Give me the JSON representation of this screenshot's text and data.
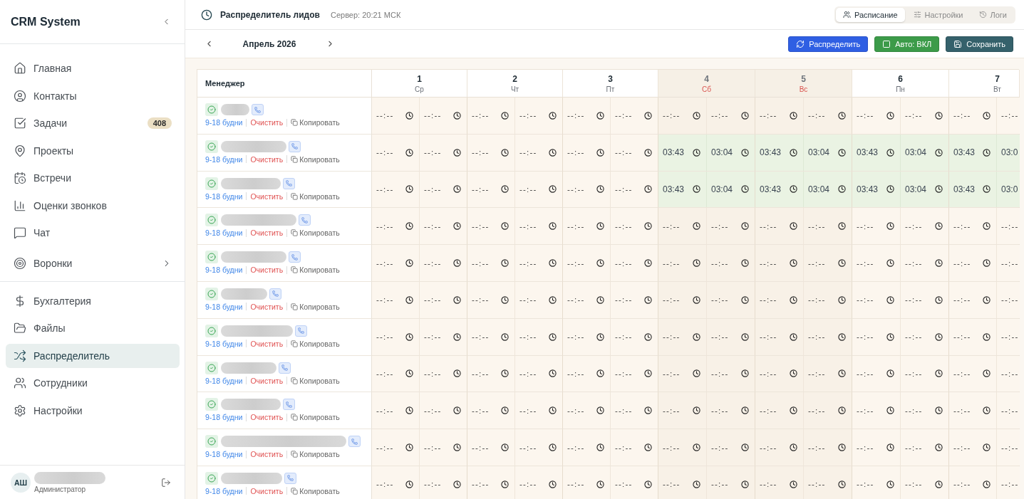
{
  "sidebar": {
    "brand": "CRM System",
    "sections": [
      {
        "items": [
          {
            "kind": "link",
            "label": "Главная",
            "selected": false
          },
          {
            "kind": "link",
            "label": "Контакты",
            "selected": false
          },
          {
            "kind": "link",
            "label": "Задачи",
            "selected": false,
            "badge": "408"
          },
          {
            "kind": "link",
            "label": "Проекты",
            "selected": false
          },
          {
            "kind": "link",
            "label": "Встречи",
            "selected": false
          },
          {
            "kind": "link",
            "label": "Оценки звонков",
            "selected": false
          },
          {
            "kind": "link",
            "label": "Чат",
            "selected": false
          },
          {
            "kind": "group",
            "label": "Воронки",
            "selected": false,
            "expanded": false
          }
        ]
      },
      {
        "items": [
          {
            "kind": "link",
            "label": "Бухгалтерия",
            "selected": false
          },
          {
            "kind": "link",
            "label": "Файлы",
            "selected": false
          },
          {
            "kind": "link",
            "label": "Распределитель",
            "selected": true
          },
          {
            "kind": "link",
            "label": "Сотрудники",
            "selected": false
          },
          {
            "kind": "link",
            "label": "Настройки",
            "selected": false
          }
        ]
      }
    ],
    "user": {
      "initials": "АШ",
      "role": "Администратор"
    }
  },
  "header": {
    "title": "Распределитель лидов",
    "server_time": "Сервер: 20:21 МСК",
    "tabs": [
      {
        "label": "Расписание",
        "selected": true
      },
      {
        "label": "Настройки",
        "selected": false
      },
      {
        "label": "Логи",
        "selected": false
      }
    ]
  },
  "toolbar": {
    "month": "Апрель 2026",
    "buttons": [
      {
        "kind": "distribute",
        "label": "Распределить"
      },
      {
        "kind": "auto",
        "label": "Авто: ВКЛ",
        "on": true
      },
      {
        "kind": "save",
        "label": "Сохранить"
      }
    ]
  },
  "table": {
    "manager_header": "Менеджер",
    "days": [
      {
        "date": "1",
        "weekday": "Ср",
        "weekend": false
      },
      {
        "date": "2",
        "weekday": "Чт",
        "weekend": false
      },
      {
        "date": "3",
        "weekday": "Пт",
        "weekend": false
      },
      {
        "date": "4",
        "weekday": "Сб",
        "weekend": true
      },
      {
        "date": "5",
        "weekday": "Вс",
        "weekend": true
      },
      {
        "date": "6",
        "weekday": "Пн",
        "weekend": false
      },
      {
        "date": "7",
        "weekday": "Вт",
        "weekend": false
      }
    ],
    "rows": [
      {
        "active": true,
        "schedule": "9-18 будни",
        "clear": "Очистить",
        "copy": "Копировать",
        "days": [
          [
            {
              "placeholder": "--:--"
            },
            {
              "placeholder": "--:--"
            }
          ],
          [
            {
              "placeholder": "--:--"
            },
            {
              "placeholder": "--:--"
            }
          ],
          [
            {
              "placeholder": "--:--"
            },
            {
              "placeholder": "--:--"
            }
          ],
          [
            {
              "placeholder": "--:--"
            },
            {
              "placeholder": "--:--"
            }
          ],
          [
            {
              "placeholder": "--:--"
            },
            {
              "placeholder": "--:--"
            }
          ],
          [
            {
              "placeholder": "--:--"
            },
            {
              "placeholder": "--:--"
            }
          ],
          [
            {
              "placeholder": "--:--"
            },
            {
              "placeholder": "--:--"
            }
          ]
        ]
      },
      {
        "active": true,
        "schedule": "9-18 будни",
        "clear": "Очистить",
        "copy": "Копировать",
        "days": [
          [
            {
              "placeholder": "--:--"
            },
            {
              "placeholder": "--:--"
            }
          ],
          [
            {
              "placeholder": "--:--"
            },
            {
              "placeholder": "--:--"
            }
          ],
          [
            {
              "placeholder": "--:--"
            },
            {
              "placeholder": "--:--"
            }
          ],
          [
            {
              "value": "03:43"
            },
            {
              "value": "03:04"
            }
          ],
          [
            {
              "value": "03:43"
            },
            {
              "value": "03:04"
            }
          ],
          [
            {
              "value": "03:43"
            },
            {
              "value": "03:04"
            }
          ],
          [
            {
              "value": "03:43"
            },
            {
              "value": "03:0"
            }
          ]
        ]
      },
      {
        "active": true,
        "schedule": "9-18 будни",
        "clear": "Очистить",
        "copy": "Копировать",
        "days": [
          [
            {
              "placeholder": "--:--"
            },
            {
              "placeholder": "--:--"
            }
          ],
          [
            {
              "placeholder": "--:--"
            },
            {
              "placeholder": "--:--"
            }
          ],
          [
            {
              "placeholder": "--:--"
            },
            {
              "placeholder": "--:--"
            }
          ],
          [
            {
              "value": "03:43"
            },
            {
              "value": "03:04"
            }
          ],
          [
            {
              "value": "03:43"
            },
            {
              "value": "03:04"
            }
          ],
          [
            {
              "value": "03:43"
            },
            {
              "value": "03:04"
            }
          ],
          [
            {
              "value": "03:43"
            },
            {
              "value": "03:0"
            }
          ]
        ]
      },
      {
        "active": true,
        "schedule": "9-18 будни",
        "clear": "Очистить",
        "copy": "Копировать",
        "days": [
          [
            {
              "placeholder": "--:--"
            },
            {
              "placeholder": "--:--"
            }
          ],
          [
            {
              "placeholder": "--:--"
            },
            {
              "placeholder": "--:--"
            }
          ],
          [
            {
              "placeholder": "--:--"
            },
            {
              "placeholder": "--:--"
            }
          ],
          [
            {
              "placeholder": "--:--"
            },
            {
              "placeholder": "--:--"
            }
          ],
          [
            {
              "placeholder": "--:--"
            },
            {
              "placeholder": "--:--"
            }
          ],
          [
            {
              "placeholder": "--:--"
            },
            {
              "placeholder": "--:--"
            }
          ],
          [
            {
              "placeholder": "--:--"
            },
            {
              "placeholder": "--:--"
            }
          ]
        ]
      },
      {
        "active": true,
        "schedule": "9-18 будни",
        "clear": "Очистить",
        "copy": "Копировать",
        "days": [
          [
            {
              "placeholder": "--:--"
            },
            {
              "placeholder": "--:--"
            }
          ],
          [
            {
              "placeholder": "--:--"
            },
            {
              "placeholder": "--:--"
            }
          ],
          [
            {
              "placeholder": "--:--"
            },
            {
              "placeholder": "--:--"
            }
          ],
          [
            {
              "placeholder": "--:--"
            },
            {
              "placeholder": "--:--"
            }
          ],
          [
            {
              "placeholder": "--:--"
            },
            {
              "placeholder": "--:--"
            }
          ],
          [
            {
              "placeholder": "--:--"
            },
            {
              "placeholder": "--:--"
            }
          ],
          [
            {
              "placeholder": "--:--"
            },
            {
              "placeholder": "--:--"
            }
          ]
        ]
      },
      {
        "active": true,
        "schedule": "9-18 будни",
        "clear": "Очистить",
        "copy": "Копировать",
        "days": [
          [
            {
              "placeholder": "--:--"
            },
            {
              "placeholder": "--:--"
            }
          ],
          [
            {
              "placeholder": "--:--"
            },
            {
              "placeholder": "--:--"
            }
          ],
          [
            {
              "placeholder": "--:--"
            },
            {
              "placeholder": "--:--"
            }
          ],
          [
            {
              "placeholder": "--:--"
            },
            {
              "placeholder": "--:--"
            }
          ],
          [
            {
              "placeholder": "--:--"
            },
            {
              "placeholder": "--:--"
            }
          ],
          [
            {
              "placeholder": "--:--"
            },
            {
              "placeholder": "--:--"
            }
          ],
          [
            {
              "placeholder": "--:--"
            },
            {
              "placeholder": "--:--"
            }
          ]
        ]
      },
      {
        "active": true,
        "schedule": "9-18 будни",
        "clear": "Очистить",
        "copy": "Копировать",
        "days": [
          [
            {
              "placeholder": "--:--"
            },
            {
              "placeholder": "--:--"
            }
          ],
          [
            {
              "placeholder": "--:--"
            },
            {
              "placeholder": "--:--"
            }
          ],
          [
            {
              "placeholder": "--:--"
            },
            {
              "placeholder": "--:--"
            }
          ],
          [
            {
              "placeholder": "--:--"
            },
            {
              "placeholder": "--:--"
            }
          ],
          [
            {
              "placeholder": "--:--"
            },
            {
              "placeholder": "--:--"
            }
          ],
          [
            {
              "placeholder": "--:--"
            },
            {
              "placeholder": "--:--"
            }
          ],
          [
            {
              "placeholder": "--:--"
            },
            {
              "placeholder": "--:--"
            }
          ]
        ]
      },
      {
        "active": true,
        "schedule": "9-18 будни",
        "clear": "Очистить",
        "copy": "Копировать",
        "days": [
          [
            {
              "placeholder": "--:--"
            },
            {
              "placeholder": "--:--"
            }
          ],
          [
            {
              "placeholder": "--:--"
            },
            {
              "placeholder": "--:--"
            }
          ],
          [
            {
              "placeholder": "--:--"
            },
            {
              "placeholder": "--:--"
            }
          ],
          [
            {
              "placeholder": "--:--"
            },
            {
              "placeholder": "--:--"
            }
          ],
          [
            {
              "placeholder": "--:--"
            },
            {
              "placeholder": "--:--"
            }
          ],
          [
            {
              "placeholder": "--:--"
            },
            {
              "placeholder": "--:--"
            }
          ],
          [
            {
              "placeholder": "--:--"
            },
            {
              "placeholder": "--:--"
            }
          ]
        ]
      },
      {
        "active": true,
        "schedule": "9-18 будни",
        "clear": "Очистить",
        "copy": "Копировать",
        "days": [
          [
            {
              "placeholder": "--:--"
            },
            {
              "placeholder": "--:--"
            }
          ],
          [
            {
              "placeholder": "--:--"
            },
            {
              "placeholder": "--:--"
            }
          ],
          [
            {
              "placeholder": "--:--"
            },
            {
              "placeholder": "--:--"
            }
          ],
          [
            {
              "placeholder": "--:--"
            },
            {
              "placeholder": "--:--"
            }
          ],
          [
            {
              "placeholder": "--:--"
            },
            {
              "placeholder": "--:--"
            }
          ],
          [
            {
              "placeholder": "--:--"
            },
            {
              "placeholder": "--:--"
            }
          ],
          [
            {
              "placeholder": "--:--"
            },
            {
              "placeholder": "--:--"
            }
          ]
        ]
      },
      {
        "active": true,
        "schedule": "9-18 будни",
        "clear": "Очистить",
        "copy": "Копировать",
        "days": [
          [
            {
              "placeholder": "--:--"
            },
            {
              "placeholder": "--:--"
            }
          ],
          [
            {
              "placeholder": "--:--"
            },
            {
              "placeholder": "--:--"
            }
          ],
          [
            {
              "placeholder": "--:--"
            },
            {
              "placeholder": "--:--"
            }
          ],
          [
            {
              "placeholder": "--:--"
            },
            {
              "placeholder": "--:--"
            }
          ],
          [
            {
              "placeholder": "--:--"
            },
            {
              "placeholder": "--:--"
            }
          ],
          [
            {
              "placeholder": "--:--"
            },
            {
              "placeholder": "--:--"
            }
          ],
          [
            {
              "placeholder": "--:--"
            },
            {
              "placeholder": "--:--"
            }
          ]
        ]
      },
      {
        "active": true,
        "schedule": "9-18 будни",
        "clear": "Очистить",
        "copy": "Копировать",
        "days": [
          [
            {
              "placeholder": "--:--"
            },
            {
              "placeholder": "--:--"
            }
          ],
          [
            {
              "placeholder": "--:--"
            },
            {
              "placeholder": "--:--"
            }
          ],
          [
            {
              "placeholder": "--:--"
            },
            {
              "placeholder": "--:--"
            }
          ],
          [
            {
              "placeholder": "--:--"
            },
            {
              "placeholder": "--:--"
            }
          ],
          [
            {
              "placeholder": "--:--"
            },
            {
              "placeholder": "--:--"
            }
          ],
          [
            {
              "placeholder": "--:--"
            },
            {
              "placeholder": "--:--"
            }
          ],
          [
            {
              "placeholder": "--:--"
            },
            {
              "placeholder": "--:--"
            }
          ]
        ]
      }
    ]
  }
}
